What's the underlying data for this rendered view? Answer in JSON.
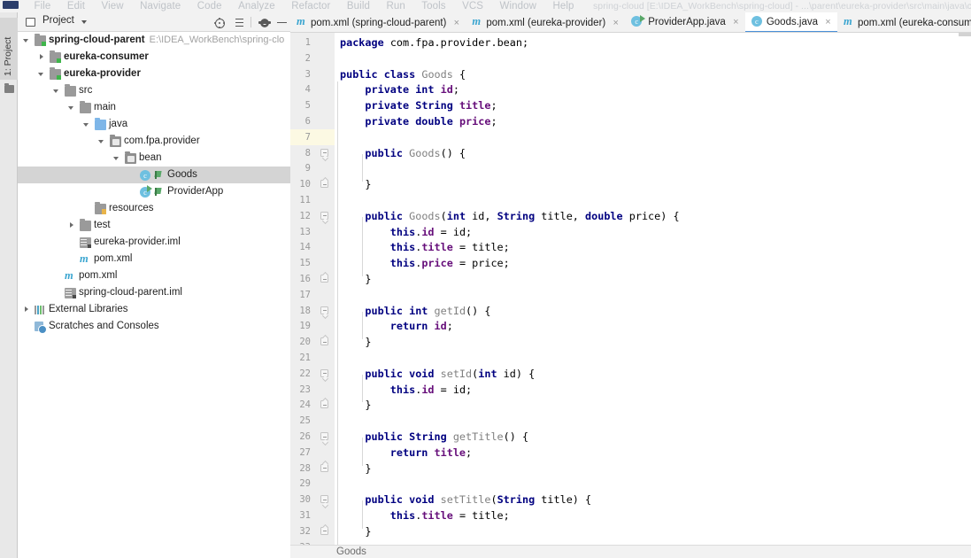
{
  "window": {
    "title": "spring-cloud [E:\\IDEA_WorkBench\\spring-cloud] - ...\\parent\\eureka-provider\\src\\main\\java\\com\\fpa\\provid",
    "menu": [
      "File",
      "Edit",
      "View",
      "Navigate",
      "Code",
      "Analyze",
      "Refactor",
      "Build",
      "Run",
      "Tools",
      "VCS",
      "Window",
      "Help"
    ]
  },
  "left_strip": {
    "tool_tab": "1: Project"
  },
  "project_panel": {
    "title": "Project",
    "buttons": [
      "locate-icon",
      "collapse-all-icon",
      "settings-gear-icon",
      "hide-icon"
    ],
    "tree": [
      {
        "indent": 0,
        "arrow": "down",
        "icon": "module-icon",
        "label": "spring-cloud-parent",
        "bold": true,
        "path": "E:\\IDEA_WorkBench\\spring-clo",
        "selected": false
      },
      {
        "indent": 1,
        "arrow": "right",
        "icon": "module-icon",
        "label": "eureka-consumer",
        "bold": true,
        "path": "",
        "selected": false
      },
      {
        "indent": 1,
        "arrow": "down",
        "icon": "module-icon",
        "label": "eureka-provider",
        "bold": true,
        "path": "",
        "selected": false
      },
      {
        "indent": 2,
        "arrow": "down",
        "icon": "folder-icon",
        "label": "src",
        "bold": false,
        "path": "",
        "selected": false
      },
      {
        "indent": 3,
        "arrow": "down",
        "icon": "folder-icon",
        "label": "main",
        "bold": false,
        "path": "",
        "selected": false
      },
      {
        "indent": 4,
        "arrow": "down",
        "icon": "source-folder-icon",
        "label": "java",
        "bold": false,
        "path": "",
        "selected": false
      },
      {
        "indent": 5,
        "arrow": "down",
        "icon": "package-icon",
        "label": "com.fpa.provider",
        "bold": false,
        "path": "",
        "selected": false
      },
      {
        "indent": 6,
        "arrow": "down",
        "icon": "package-icon",
        "label": "bean",
        "bold": false,
        "path": "",
        "selected": false
      },
      {
        "indent": 7,
        "arrow": "none",
        "icon": "java-class-icon",
        "label": "Goods",
        "bold": false,
        "path": "",
        "selected": true
      },
      {
        "indent": 7,
        "arrow": "none",
        "icon": "java-runnable-class-icon",
        "label": "ProviderApp",
        "bold": false,
        "path": "",
        "selected": false
      },
      {
        "indent": 4,
        "arrow": "none",
        "icon": "resources-folder-icon",
        "label": "resources",
        "bold": false,
        "path": "",
        "selected": false
      },
      {
        "indent": 3,
        "arrow": "right",
        "icon": "folder-icon",
        "label": "test",
        "bold": false,
        "path": "",
        "selected": false
      },
      {
        "indent": 3,
        "arrow": "none",
        "icon": "iml-file-icon",
        "label": "eureka-provider.iml",
        "bold": false,
        "path": "",
        "selected": false
      },
      {
        "indent": 3,
        "arrow": "none",
        "icon": "maven-file-icon",
        "label": "pom.xml",
        "bold": false,
        "path": "",
        "selected": false
      },
      {
        "indent": 2,
        "arrow": "none",
        "icon": "maven-file-icon",
        "label": "pom.xml",
        "bold": false,
        "path": "",
        "selected": false
      },
      {
        "indent": 2,
        "arrow": "none",
        "icon": "iml-file-icon",
        "label": "spring-cloud-parent.iml",
        "bold": false,
        "path": "",
        "selected": false
      },
      {
        "indent": 0,
        "arrow": "right",
        "icon": "external-libraries-icon",
        "label": "External Libraries",
        "bold": false,
        "path": "",
        "selected": false
      },
      {
        "indent": 0,
        "arrow": "none",
        "icon": "scratches-icon",
        "label": "Scratches and Consoles",
        "bold": false,
        "path": "",
        "selected": false
      }
    ]
  },
  "editor_tabs": [
    {
      "icon": "maven-file-icon",
      "label": "pom.xml (spring-cloud-parent)",
      "active": false,
      "close": "×"
    },
    {
      "icon": "maven-file-icon",
      "label": "pom.xml (eureka-provider)",
      "active": false,
      "close": "×"
    },
    {
      "icon": "java-runnable-class-icon",
      "label": "ProviderApp.java",
      "active": false,
      "close": "×"
    },
    {
      "icon": "java-class-icon",
      "label": "Goods.java",
      "active": true,
      "close": "×"
    },
    {
      "icon": "maven-file-icon",
      "label": "pom.xml (eureka-consumer",
      "active": false,
      "close": ""
    }
  ],
  "editor": {
    "highlighted_line": 7,
    "lines": [
      {
        "n": 1,
        "indent": 0,
        "tokens": [
          {
            "t": "package ",
            "c": "kw"
          },
          {
            "t": "com.fpa.provider.bean;",
            "c": "pl"
          }
        ]
      },
      {
        "n": 2,
        "indent": 0,
        "tokens": []
      },
      {
        "n": 3,
        "indent": 0,
        "tokens": [
          {
            "t": "public class ",
            "c": "kw"
          },
          {
            "t": "Goods ",
            "c": "ty"
          },
          {
            "t": "{",
            "c": "pl"
          }
        ]
      },
      {
        "n": 4,
        "indent": 1,
        "tokens": [
          {
            "t": "private int ",
            "c": "kw"
          },
          {
            "t": "id",
            "c": "fld"
          },
          {
            "t": ";",
            "c": "pl"
          }
        ]
      },
      {
        "n": 5,
        "indent": 1,
        "tokens": [
          {
            "t": "private ",
            "c": "kw"
          },
          {
            "t": "String ",
            "c": "kw"
          },
          {
            "t": "title",
            "c": "fld"
          },
          {
            "t": ";",
            "c": "pl"
          }
        ]
      },
      {
        "n": 6,
        "indent": 1,
        "tokens": [
          {
            "t": "private double ",
            "c": "kw"
          },
          {
            "t": "price",
            "c": "fld"
          },
          {
            "t": ";",
            "c": "pl"
          }
        ]
      },
      {
        "n": 7,
        "indent": 0,
        "tokens": []
      },
      {
        "n": 8,
        "indent": 1,
        "tokens": [
          {
            "t": "public ",
            "c": "kw"
          },
          {
            "t": "Goods",
            "c": "ty"
          },
          {
            "t": "() {",
            "c": "pl"
          }
        ]
      },
      {
        "n": 9,
        "indent": 0,
        "tokens": []
      },
      {
        "n": 10,
        "indent": 1,
        "tokens": [
          {
            "t": "}",
            "c": "pl"
          }
        ]
      },
      {
        "n": 11,
        "indent": 0,
        "tokens": []
      },
      {
        "n": 12,
        "indent": 1,
        "tokens": [
          {
            "t": "public ",
            "c": "kw"
          },
          {
            "t": "Goods",
            "c": "ty"
          },
          {
            "t": "(",
            "c": "pl"
          },
          {
            "t": "int ",
            "c": "kw"
          },
          {
            "t": "id, ",
            "c": "pl"
          },
          {
            "t": "String ",
            "c": "kw"
          },
          {
            "t": "title, ",
            "c": "pl"
          },
          {
            "t": "double ",
            "c": "kw"
          },
          {
            "t": "price) {",
            "c": "pl"
          }
        ]
      },
      {
        "n": 13,
        "indent": 2,
        "tokens": [
          {
            "t": "this",
            "c": "kw"
          },
          {
            "t": ".",
            "c": "pl"
          },
          {
            "t": "id",
            "c": "fld"
          },
          {
            "t": " = id;",
            "c": "pl"
          }
        ]
      },
      {
        "n": 14,
        "indent": 2,
        "tokens": [
          {
            "t": "this",
            "c": "kw"
          },
          {
            "t": ".",
            "c": "pl"
          },
          {
            "t": "title",
            "c": "fld"
          },
          {
            "t": " = title;",
            "c": "pl"
          }
        ]
      },
      {
        "n": 15,
        "indent": 2,
        "tokens": [
          {
            "t": "this",
            "c": "kw"
          },
          {
            "t": ".",
            "c": "pl"
          },
          {
            "t": "price",
            "c": "fld"
          },
          {
            "t": " = price;",
            "c": "pl"
          }
        ]
      },
      {
        "n": 16,
        "indent": 1,
        "tokens": [
          {
            "t": "}",
            "c": "pl"
          }
        ]
      },
      {
        "n": 17,
        "indent": 0,
        "tokens": []
      },
      {
        "n": 18,
        "indent": 1,
        "tokens": [
          {
            "t": "public int ",
            "c": "kw"
          },
          {
            "t": "getId",
            "c": "ty"
          },
          {
            "t": "() {",
            "c": "pl"
          }
        ]
      },
      {
        "n": 19,
        "indent": 2,
        "tokens": [
          {
            "t": "return ",
            "c": "kw"
          },
          {
            "t": "id",
            "c": "fld"
          },
          {
            "t": ";",
            "c": "pl"
          }
        ]
      },
      {
        "n": 20,
        "indent": 1,
        "tokens": [
          {
            "t": "}",
            "c": "pl"
          }
        ]
      },
      {
        "n": 21,
        "indent": 0,
        "tokens": []
      },
      {
        "n": 22,
        "indent": 1,
        "tokens": [
          {
            "t": "public void ",
            "c": "kw"
          },
          {
            "t": "setId",
            "c": "ty"
          },
          {
            "t": "(",
            "c": "pl"
          },
          {
            "t": "int ",
            "c": "kw"
          },
          {
            "t": "id) {",
            "c": "pl"
          }
        ]
      },
      {
        "n": 23,
        "indent": 2,
        "tokens": [
          {
            "t": "this",
            "c": "kw"
          },
          {
            "t": ".",
            "c": "pl"
          },
          {
            "t": "id",
            "c": "fld"
          },
          {
            "t": " = id;",
            "c": "pl"
          }
        ]
      },
      {
        "n": 24,
        "indent": 1,
        "tokens": [
          {
            "t": "}",
            "c": "pl"
          }
        ]
      },
      {
        "n": 25,
        "indent": 0,
        "tokens": []
      },
      {
        "n": 26,
        "indent": 1,
        "tokens": [
          {
            "t": "public ",
            "c": "kw"
          },
          {
            "t": "String ",
            "c": "kw"
          },
          {
            "t": "getTitle",
            "c": "ty"
          },
          {
            "t": "() {",
            "c": "pl"
          }
        ]
      },
      {
        "n": 27,
        "indent": 2,
        "tokens": [
          {
            "t": "return ",
            "c": "kw"
          },
          {
            "t": "title",
            "c": "fld"
          },
          {
            "t": ";",
            "c": "pl"
          }
        ]
      },
      {
        "n": 28,
        "indent": 1,
        "tokens": [
          {
            "t": "}",
            "c": "pl"
          }
        ]
      },
      {
        "n": 29,
        "indent": 0,
        "tokens": []
      },
      {
        "n": 30,
        "indent": 1,
        "tokens": [
          {
            "t": "public void ",
            "c": "kw"
          },
          {
            "t": "setTitle",
            "c": "ty"
          },
          {
            "t": "(",
            "c": "pl"
          },
          {
            "t": "String ",
            "c": "kw"
          },
          {
            "t": "title) {",
            "c": "pl"
          }
        ]
      },
      {
        "n": 31,
        "indent": 2,
        "tokens": [
          {
            "t": "this",
            "c": "kw"
          },
          {
            "t": ".",
            "c": "pl"
          },
          {
            "t": "title",
            "c": "fld"
          },
          {
            "t": " = title;",
            "c": "pl"
          }
        ]
      },
      {
        "n": 32,
        "indent": 1,
        "tokens": [
          {
            "t": "}",
            "c": "pl"
          }
        ]
      },
      {
        "n": 33,
        "indent": 0,
        "tokens": []
      }
    ],
    "fold_markers": [
      {
        "line": 8,
        "type": "tip"
      },
      {
        "line": 10,
        "type": "end"
      },
      {
        "line": 12,
        "type": "tip"
      },
      {
        "line": 16,
        "type": "end"
      },
      {
        "line": 18,
        "type": "tip"
      },
      {
        "line": 20,
        "type": "end"
      },
      {
        "line": 22,
        "type": "tip"
      },
      {
        "line": 24,
        "type": "end"
      },
      {
        "line": 26,
        "type": "tip"
      },
      {
        "line": 28,
        "type": "end"
      },
      {
        "line": 30,
        "type": "tip"
      },
      {
        "line": 32,
        "type": "end"
      }
    ]
  },
  "breadcrumb": {
    "text": "Goods"
  },
  "colors": {
    "accent": "#4a90d9",
    "selection": "#d4d4d4",
    "caret_line": "#fcf9e3",
    "keyword": "#000080",
    "field": "#660e7a",
    "type": "#808080",
    "gutter_bg": "#eeeeee"
  }
}
